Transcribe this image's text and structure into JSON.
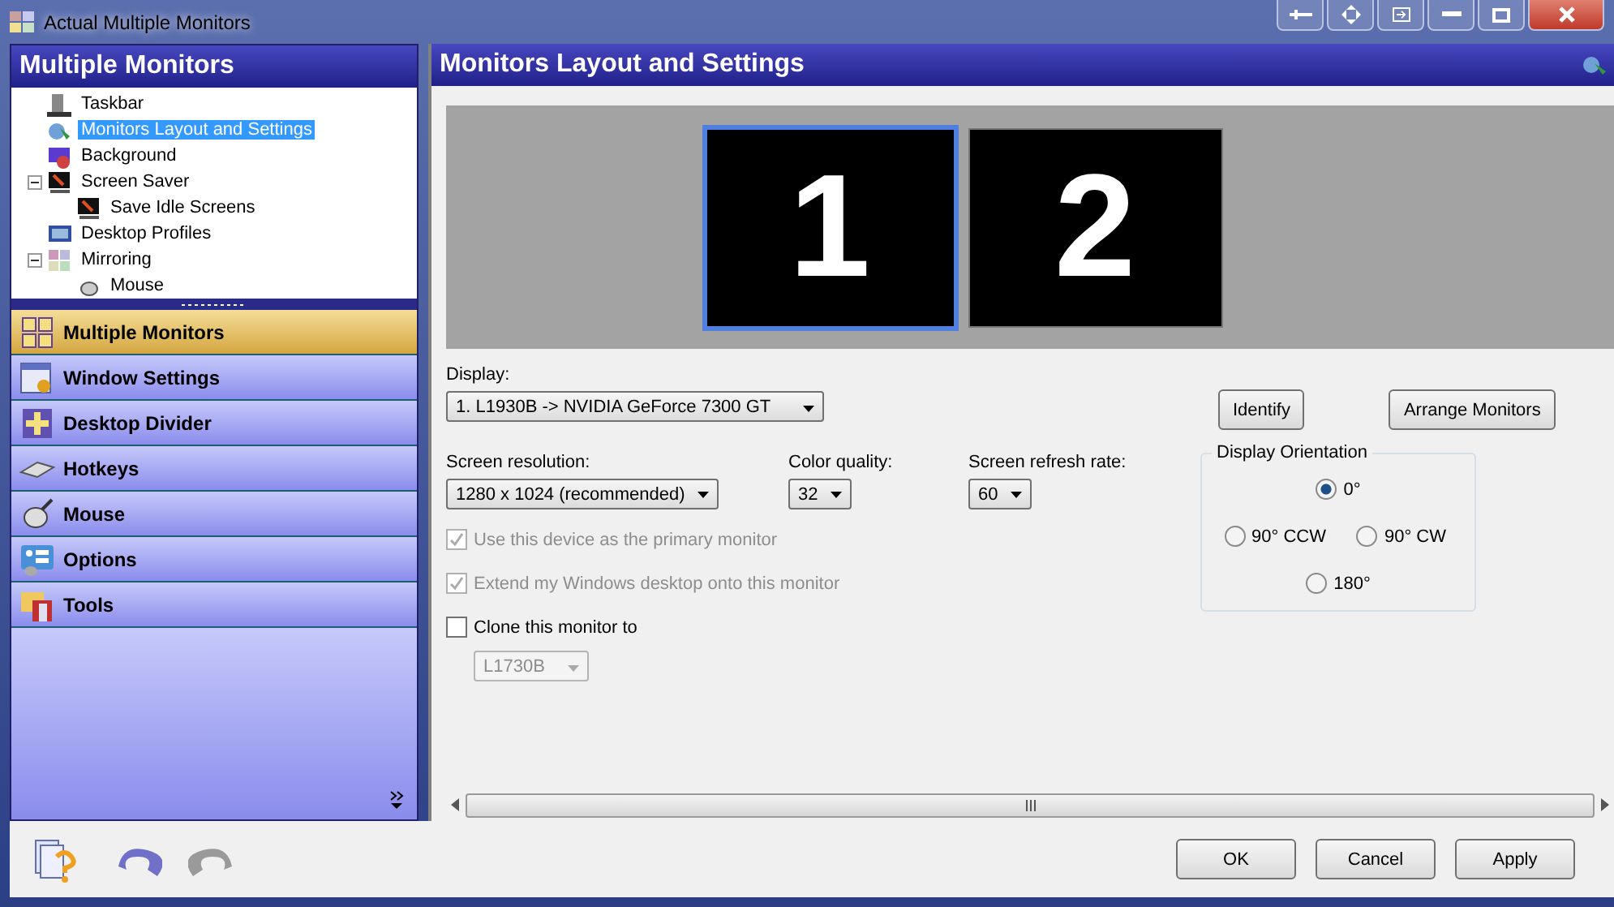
{
  "window": {
    "title": "Actual Multiple Monitors"
  },
  "left_panel": {
    "title": "Multiple Monitors",
    "tree": [
      {
        "label": "Taskbar",
        "selected": false
      },
      {
        "label": "Monitors Layout and Settings",
        "selected": true
      },
      {
        "label": "Background",
        "selected": false
      },
      {
        "label": "Screen Saver",
        "selected": false,
        "expanded": true,
        "children": [
          {
            "label": "Save Idle Screens",
            "selected": false
          }
        ]
      },
      {
        "label": "Desktop Profiles",
        "selected": false
      },
      {
        "label": "Mirroring",
        "selected": false,
        "expanded": true,
        "children": [
          {
            "label": "Mouse",
            "selected": false
          }
        ]
      }
    ],
    "nav": [
      {
        "label": "Multiple Monitors",
        "selected": true
      },
      {
        "label": "Window Settings",
        "selected": false
      },
      {
        "label": "Desktop Divider",
        "selected": false
      },
      {
        "label": "Hotkeys",
        "selected": false
      },
      {
        "label": "Mouse",
        "selected": false
      },
      {
        "label": "Options",
        "selected": false
      },
      {
        "label": "Tools",
        "selected": false
      }
    ]
  },
  "right_panel": {
    "title": "Monitors Layout and Settings",
    "monitors": [
      {
        "label": "1",
        "selected": true
      },
      {
        "label": "2",
        "selected": false
      }
    ],
    "display": {
      "label": "Display:",
      "value": "1. L1930B -> NVIDIA GeForce 7300 GT"
    },
    "buttons": [
      "Identify",
      "Arrange Monitors"
    ],
    "dropdowns": [
      {
        "label": "Screen resolution:",
        "value": "1280 x 1024 (recommended)"
      },
      {
        "label": "Color quality:",
        "value": "32"
      },
      {
        "label": "Screen refresh rate:",
        "value": "60"
      }
    ],
    "checkboxes": [
      {
        "label": "Use this device as the primary monitor",
        "checked": true,
        "disabled": true
      },
      {
        "label": "Extend my Windows desktop onto this monitor",
        "checked": true,
        "disabled": true
      },
      {
        "label": "Clone this monitor to",
        "checked": false,
        "disabled": false
      }
    ],
    "clone_target": {
      "value": "L1730B",
      "disabled": true
    },
    "orientation": {
      "title": "Display Orientation",
      "options": [
        {
          "label": "0°",
          "selected": true
        },
        {
          "label": "90° CCW",
          "selected": false
        },
        {
          "label": "90° CW",
          "selected": false
        },
        {
          "label": "180°",
          "selected": false
        }
      ]
    }
  },
  "footer_buttons": [
    "OK",
    "Cancel",
    "Apply"
  ]
}
